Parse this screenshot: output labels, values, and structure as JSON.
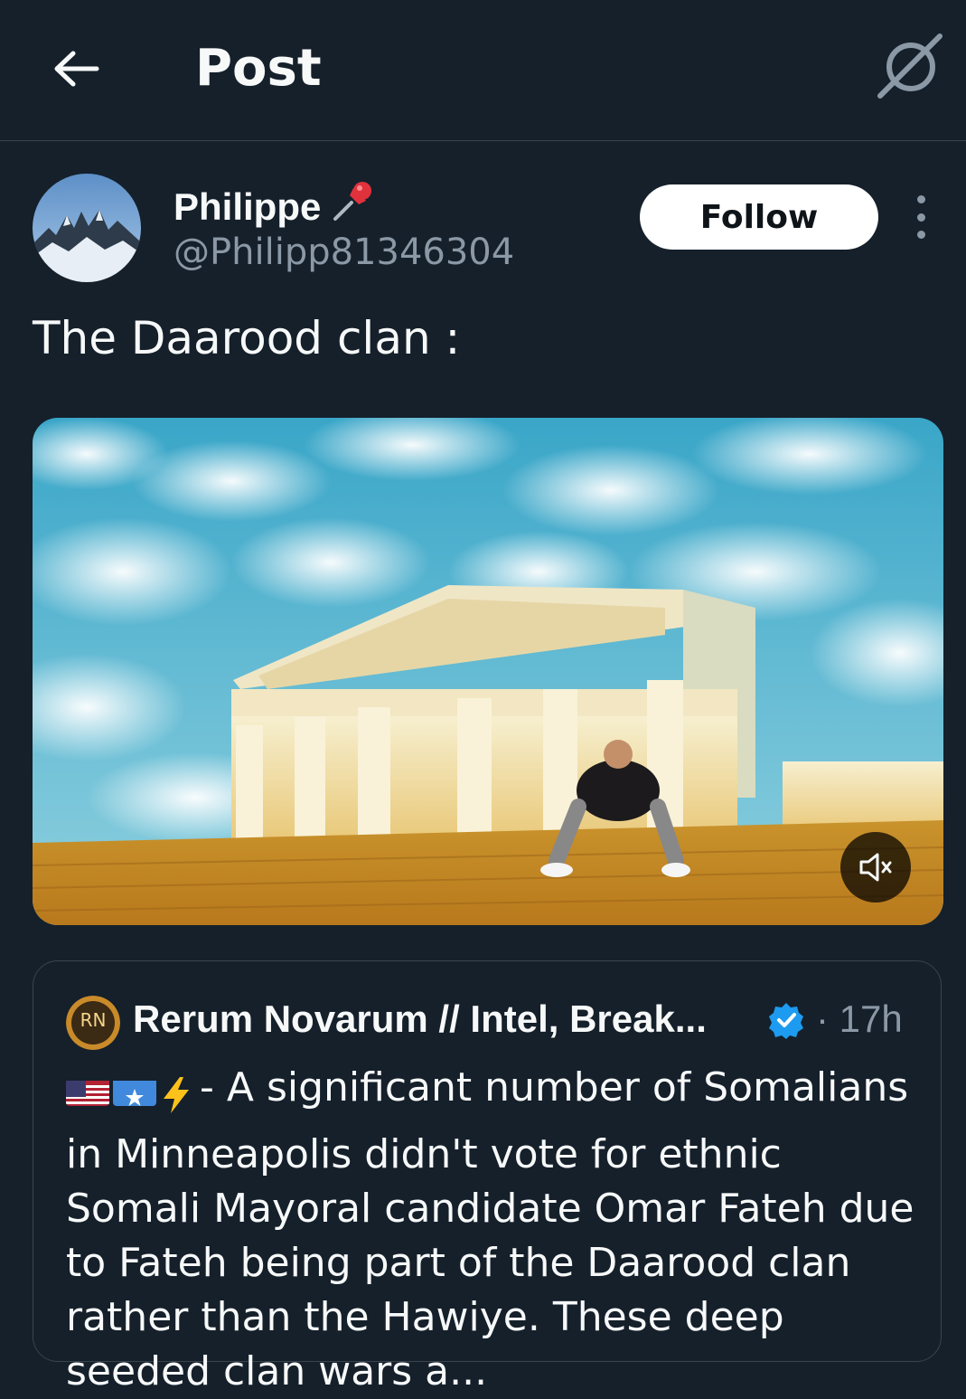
{
  "header": {
    "title": "Post",
    "back_icon": "arrow-left-icon",
    "grok_icon": "grok-icon"
  },
  "author": {
    "name": "Philippe",
    "pin_emoji": "📌",
    "handle": "@Philipp81346304",
    "follow_label": "Follow"
  },
  "post": {
    "text": "The Daarood clan :"
  },
  "media": {
    "mute_icon": "volume-muted-icon"
  },
  "quote": {
    "avatar_text": "RN",
    "name": "Rerum Novarum // Intel, Break...",
    "time": "· 17h",
    "emoji_prefix": "🇺🇸🇸🇴⚡",
    "body": "- A significant number of Somalians in Minneapolis didn't vote for ethnic Somali Mayoral candidate Omar Fateh due to Fateh being part of the Daarood clan rather than the Hawiye. These deep seeded clan wars a..."
  },
  "colors": {
    "background": "#15202b",
    "text": "#f7f9f9",
    "secondary": "#8b98a5",
    "border": "#38444d",
    "verified": "#1d9bf0"
  }
}
